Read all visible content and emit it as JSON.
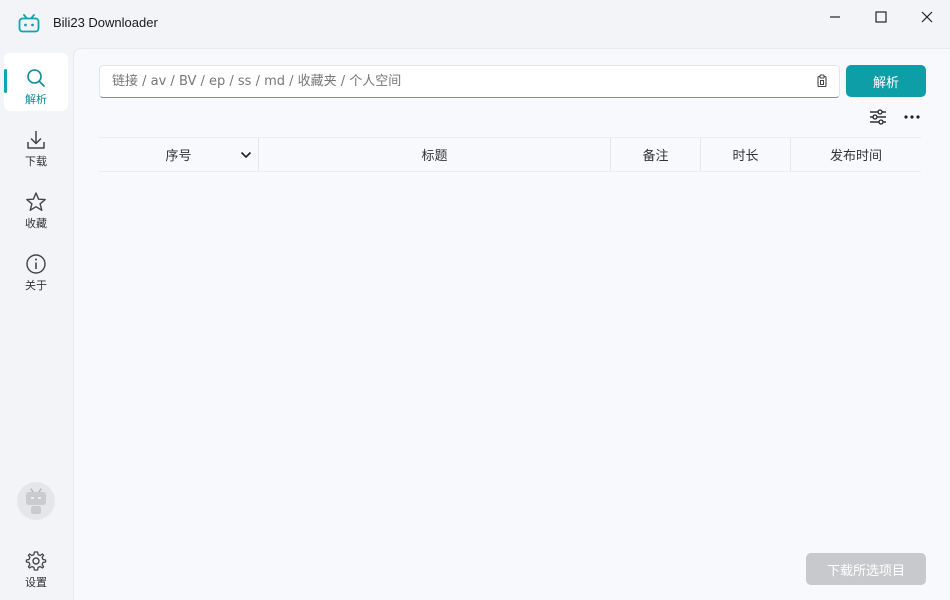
{
  "window": {
    "title": "Bili23 Downloader",
    "accent": "#0d9ea8"
  },
  "sidebar": {
    "items": [
      {
        "label": "解析",
        "icon": "search-icon",
        "active": true
      },
      {
        "label": "下载",
        "icon": "download-icon",
        "active": false
      },
      {
        "label": "收藏",
        "icon": "star-icon",
        "active": false
      },
      {
        "label": "关于",
        "icon": "info-icon",
        "active": false
      }
    ],
    "settings_label": "设置"
  },
  "main": {
    "url_placeholder": "链接 / av / BV / ep / ss / md / 收藏夹 / 个人空间",
    "parse_label": "解析",
    "table_headers": {
      "index": "序号",
      "title": "标题",
      "note": "备注",
      "duration": "时长",
      "publish_time": "发布时间"
    },
    "download_selected_label": "下载所选项目"
  }
}
